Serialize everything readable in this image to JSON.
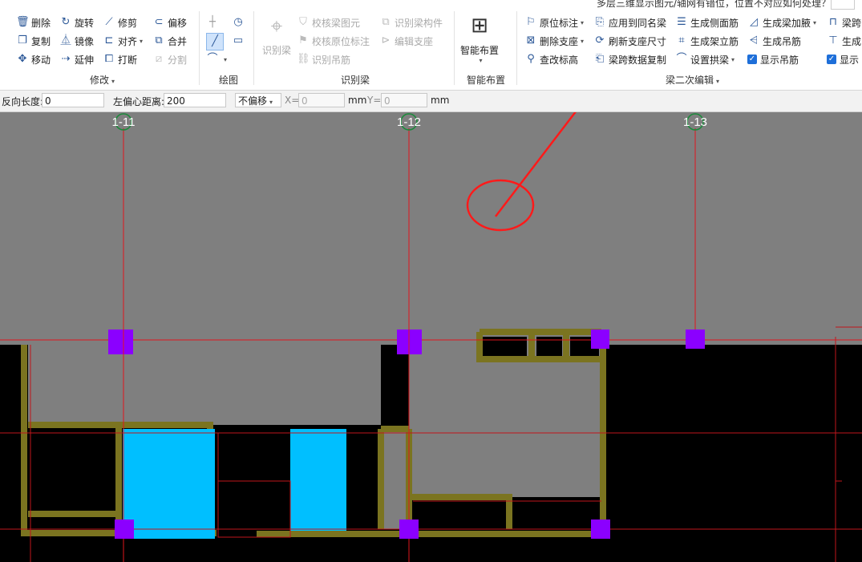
{
  "top_hint": "多层三维显示图元/轴网有错位，位置不对应如何处理？",
  "modify": {
    "group_label": "修改",
    "delete": "删除",
    "rotate": "旋转",
    "trim": "修剪",
    "offset": "偏移",
    "copy": "复制",
    "mirror": "镜像",
    "align": "对齐",
    "merge": "合并",
    "move": "移动",
    "extend": "延伸",
    "break": "打断",
    "split": "分割"
  },
  "draw": {
    "group_label": "绘图"
  },
  "recognize": {
    "group_label": "识别梁",
    "identify_beam": "识别梁",
    "check_beam_elements": "校核梁图元",
    "identify_beam_members": "识别梁构件",
    "check_in_situ_annotation": "校核原位标注",
    "edit_support": "编辑支座",
    "identify_hanger_bars": "识别吊筋"
  },
  "smart": {
    "group_label": "智能布置",
    "smart_layout": "智能布置"
  },
  "beam_edit": {
    "group_label": "梁二次编辑",
    "in_situ_annotation": "原位标注",
    "apply_same_beam": "应用到同名梁",
    "generate_side_bars": "生成侧面筋",
    "generate_haunch": "生成梁加腋",
    "span": "梁跨",
    "delete_support": "删除支座",
    "refresh_support_size": "刷新支座尺寸",
    "generate_stirrup_bars": "生成架立筋",
    "generate_hanger": "生成吊筋",
    "generate": "生成",
    "modify_elevation": "查改标高",
    "span_data_copy": "梁跨数据复制",
    "set_arch_beam": "设置拱梁",
    "show_hanger_bars": "显示吊筋",
    "show": "显示"
  },
  "options": {
    "reverse_length_label": "反向长度:",
    "reverse_length_value": "0",
    "left_offset_label": "左偏心距离:",
    "left_offset_value": "200",
    "offset_mode": "不偏移",
    "x_label": "X=",
    "x_value": "0",
    "unit1": "mm",
    "y_label": "Y=",
    "y_value": "0",
    "unit2": "mm"
  },
  "axes": [
    "1-11",
    "1-12",
    "1-13"
  ],
  "colors": {
    "canvas_bg": "#7f7f7f",
    "axis_line": "#e0161c",
    "column": "#8b00ff",
    "beam": "#7b7420",
    "slab": "#00bfff",
    "annotation": "#ff1a1a"
  }
}
